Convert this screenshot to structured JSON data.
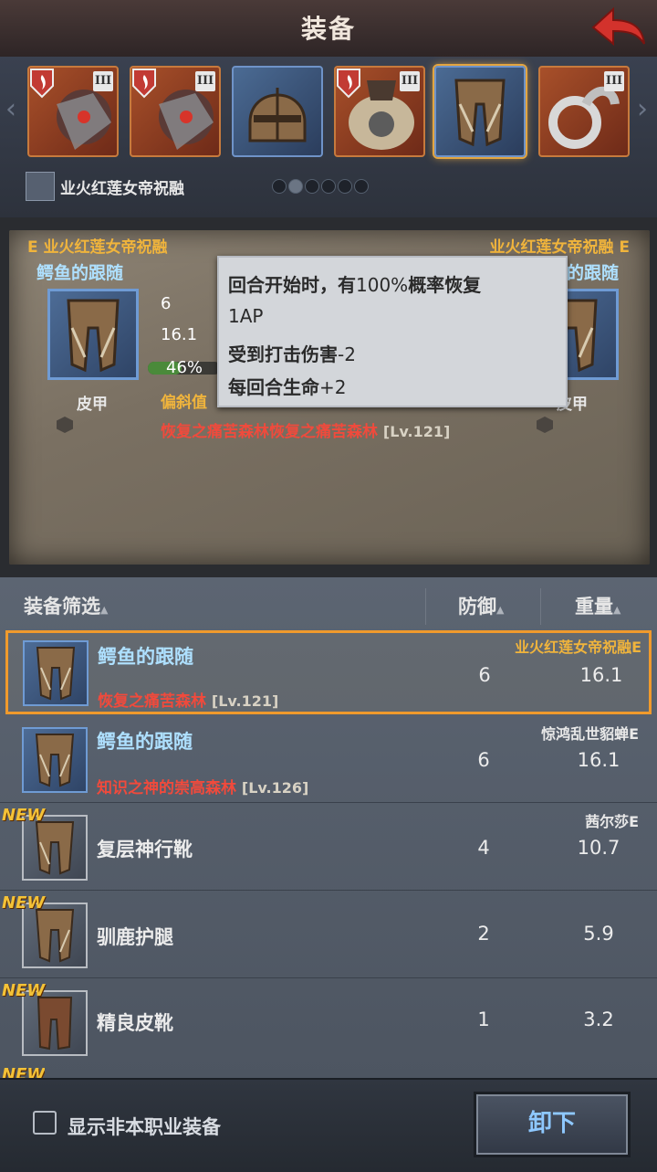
{
  "header": {
    "title": "装备"
  },
  "slots": [
    {
      "tier": "III",
      "has_shield": true,
      "kind": "chest-armor"
    },
    {
      "tier": "III",
      "has_shield": true,
      "kind": "chest-armor"
    },
    {
      "tier": "",
      "has_shield": false,
      "kind": "helmet"
    },
    {
      "tier": "III",
      "has_shield": true,
      "kind": "fur-armor"
    },
    {
      "tier": "",
      "has_shield": false,
      "kind": "leg-armor"
    },
    {
      "tier": "III",
      "has_shield": false,
      "kind": "silver-accessory"
    }
  ],
  "owner": {
    "name": "业火红莲女帝祝融"
  },
  "pagination": {
    "pages": 6,
    "current": 2
  },
  "compare": {
    "left": {
      "owner": "业火红莲女帝祝融",
      "grade": "E",
      "item_name": "鳄鱼的跟随",
      "type": "皮甲"
    },
    "right": {
      "owner": "业火红莲女帝祝融",
      "grade": "E",
      "item_name": "鳄鱼的跟随",
      "type": "皮甲"
    },
    "stats": {
      "defense": "6",
      "weight": "16.1",
      "progress": "46%",
      "deflect_label": "偏斜值"
    },
    "source_a": "恢复之痛苦森林",
    "source_b": "恢复之痛苦森林",
    "source_lv": "[Lv.121]"
  },
  "tooltip": {
    "line1a": "回合开始时，有",
    "line1b": "100%",
    "line1c": "概率恢复",
    "line2": "1AP",
    "line3a": "受到打击伤害",
    "line3b": "-2",
    "line4a": "每回合生命",
    "line4b": "+2"
  },
  "list": {
    "headers": {
      "filter": "装备筛选",
      "defense": "防御",
      "weight": "重量"
    },
    "new_label": "NEW",
    "rows": [
      {
        "name": "鳄鱼的跟随",
        "source": "恢复之痛苦森林",
        "lv": "[Lv.121]",
        "owner": "业火红莲女帝祝融E",
        "defense": "6",
        "weight": "16.1",
        "is_new": false,
        "selected": true
      },
      {
        "name": "鳄鱼的跟随",
        "source": "知识之神的崇高森林",
        "lv": "[Lv.126]",
        "owner": "惊鸿乱世貂蝉E",
        "defense": "6",
        "weight": "16.1",
        "is_new": false,
        "selected": false
      },
      {
        "name": "复层神行靴",
        "source": "",
        "lv": "",
        "owner": "茜尔莎E",
        "defense": "4",
        "weight": "10.7",
        "is_new": true,
        "selected": false
      },
      {
        "name": "驯鹿护腿",
        "source": "",
        "lv": "",
        "owner": "",
        "defense": "2",
        "weight": "5.9",
        "is_new": true,
        "selected": false
      },
      {
        "name": "精良皮靴",
        "source": "",
        "lv": "",
        "owner": "",
        "defense": "1",
        "weight": "3.2",
        "is_new": true,
        "selected": false
      }
    ]
  },
  "footer": {
    "checkbox_label": "显示非本职业装备",
    "unequip_label": "卸下"
  },
  "colors": {
    "accent_orange": "#f0b43c",
    "name_blue": "#aee0ff",
    "source_red": "#f04a3c",
    "new_yellow": "#f4c237"
  }
}
